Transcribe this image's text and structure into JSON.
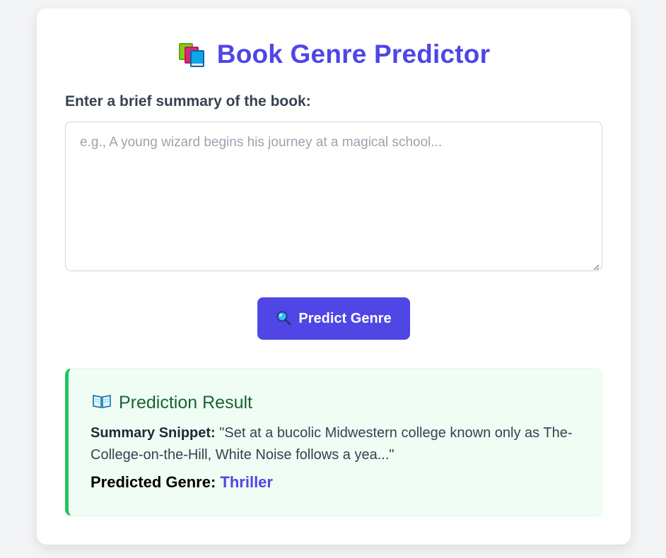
{
  "app": {
    "title": "Book Genre Predictor",
    "title_icon": "books-icon"
  },
  "form": {
    "label": "Enter a brief summary of the book:",
    "summary_value": "",
    "summary_placeholder": "e.g., A young wizard begins his journey at a magical school...",
    "submit_label": "Predict Genre",
    "submit_icon": "magnifier-icon"
  },
  "result": {
    "heading": "Prediction Result",
    "heading_icon": "open-book-icon",
    "snippet_label": "Summary Snippet:",
    "snippet_text": "\"Set at a bucolic Midwestern college known only as The-College-on-the-Hill, White Noise follows a yea...\"",
    "genre_label": "Predicted Genre:",
    "genre_value": "Thriller"
  },
  "colors": {
    "accent": "#4f46e5",
    "success_border": "#22c55e",
    "success_bg": "#f0fdf4",
    "success_text": "#166534"
  }
}
